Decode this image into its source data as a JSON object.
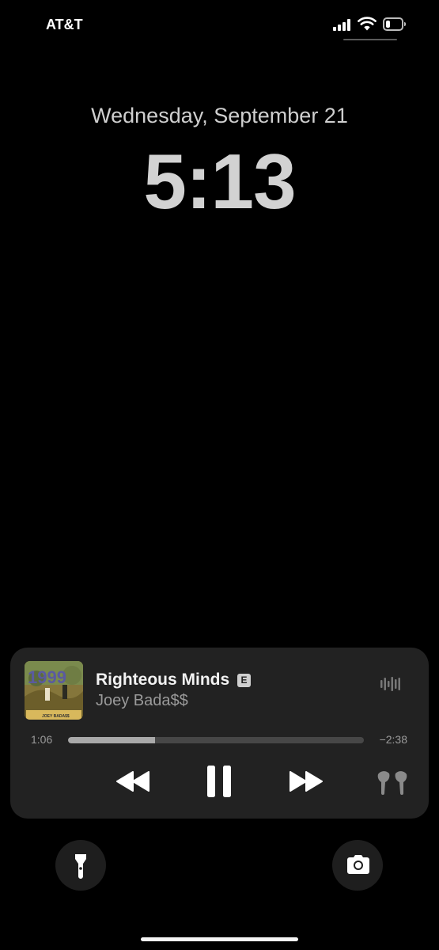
{
  "status_bar": {
    "carrier": "AT&T",
    "battery_level": 0.3,
    "signal_bars": 4
  },
  "lock_screen": {
    "date": "Wednesday, September 21",
    "time": "5:13"
  },
  "now_playing": {
    "album_art": {
      "title_text": "1999",
      "artist_text": "JOEY BADA$$"
    },
    "song_title": "Righteous Minds",
    "explicit_badge": "E",
    "artist": "Joey Bada$$",
    "elapsed": "1:06",
    "remaining": "−2:38",
    "progress": 0.294,
    "controls": [
      "rewind-icon",
      "pause-icon",
      "fast-forward-icon",
      "airpods-icon"
    ]
  },
  "quick_actions": [
    "flashlight-icon",
    "camera-icon"
  ],
  "colors": {
    "background": "#000000",
    "player_background": "#222222",
    "clock_text": "#d2d2d2",
    "secondary_text": "#9a9a9a"
  }
}
